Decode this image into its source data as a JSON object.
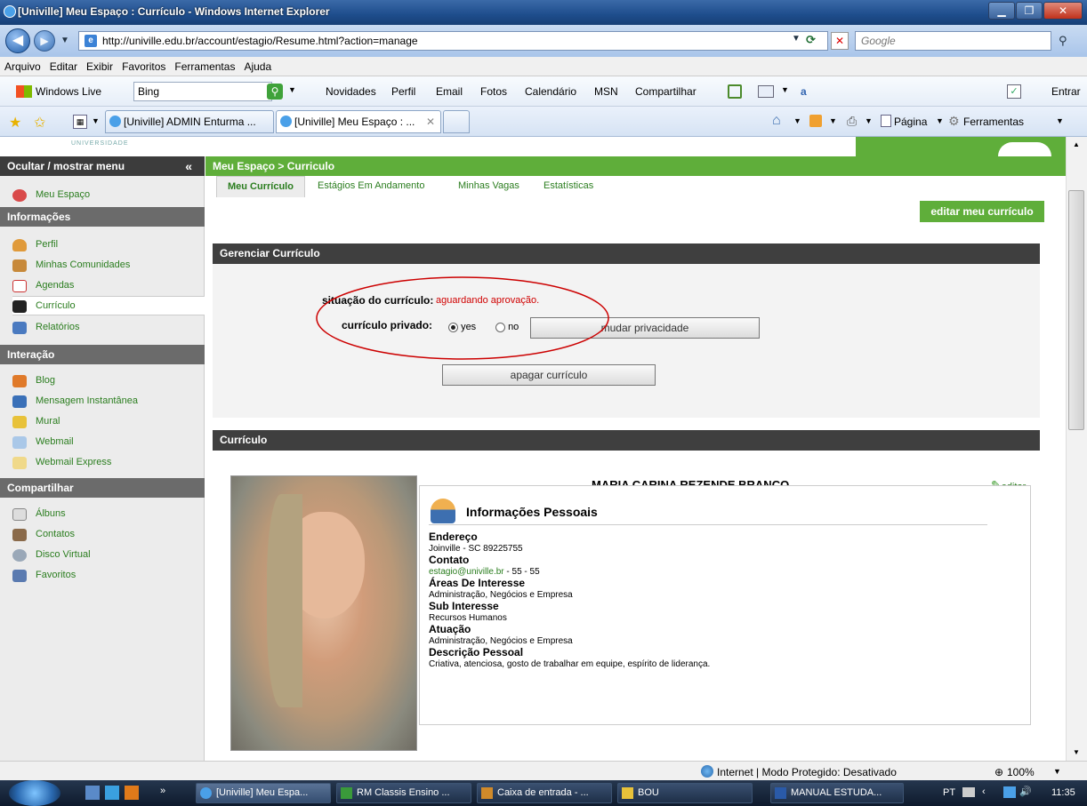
{
  "window": {
    "title": "[Univille] Meu Espaço : Currículo - Windows Internet Explorer"
  },
  "address": {
    "url": "http://univille.edu.br/account/estagio/Resume.html?action=manage",
    "search_placeholder": "Google"
  },
  "menu": [
    "Arquivo",
    "Editar",
    "Exibir",
    "Favoritos",
    "Ferramentas",
    "Ajuda"
  ],
  "livebar": {
    "brand": "Windows Live",
    "search_value": "Bing",
    "links": [
      "Novidades",
      "Perfil",
      "Email",
      "Fotos",
      "Calendário",
      "MSN",
      "Compartilhar"
    ],
    "signin": "Entrar"
  },
  "tabs": [
    "[Univille] ADMIN Enturma ...",
    "[Univille] Meu Espaço : ..."
  ],
  "tools": {
    "page": "Página",
    "tools": "Ferramentas"
  },
  "header": {
    "logo": "UNIVERSIDADE"
  },
  "sidebar": {
    "toggle": "Ocultar / mostrar menu",
    "home": "Meu Espaço",
    "sections": [
      {
        "title": "Informações",
        "items": [
          "Perfil",
          "Minhas Comunidades",
          "Agendas",
          "Currículo",
          "Relatórios"
        ]
      },
      {
        "title": "Interação",
        "items": [
          "Blog",
          "Mensagem Instantânea",
          "Mural",
          "Webmail",
          "Webmail Express"
        ]
      },
      {
        "title": "Compartilhar",
        "items": [
          "Álbuns",
          "Contatos",
          "Disco Virtual",
          "Favoritos"
        ]
      }
    ]
  },
  "content": {
    "breadcrumb": "Meu Espaço > Curriculo",
    "subtabs": [
      "Meu Currículo",
      "Estágios Em Andamento",
      "Minhas Vagas",
      "Estatísticas"
    ],
    "edit_cv": "editar meu currículo",
    "manage": {
      "title": "Gerenciar Currículo",
      "status_label": "situação do currículo:",
      "status_value": "aguardando aprovação.",
      "private_label": "currículo privado:",
      "opt_yes": "yes",
      "opt_no": "no",
      "change_privacy": "mudar privacidade",
      "delete_cv": "apagar currículo"
    },
    "cv": {
      "title": "Currículo",
      "name": "MARIA CARINA REZENDE BRANCO",
      "edit": "editar",
      "section_title": "Informações Pessoais",
      "address_label": "Endereço",
      "address_value": "Joinville - SC 89225755",
      "contact_label": "Contato",
      "contact_email": "estagio@univille.br",
      "contact_phone": "- 55 - 55",
      "interest_label": "Áreas De Interesse",
      "interest_value": "Administração, Negócios e Empresa",
      "sub_label": "Sub Interesse",
      "sub_value": "Recursos Humanos",
      "acting_label": "Atuação",
      "acting_value": "Administração, Negócios e Empresa",
      "desc_label": "Descrição Pessoal",
      "desc_value": "Criativa, atenciosa, gosto de trabalhar em equipe, espírito de liderança."
    }
  },
  "status": {
    "zone": "Internet | Modo Protegido: Desativado",
    "zoom": "100%"
  },
  "taskbar": {
    "tasks": [
      "[Univille] Meu Espa...",
      "RM Classis Ensino ...",
      "Caixa de entrada - ...",
      "BOU",
      "MANUAL ESTUDA..."
    ],
    "lang": "PT",
    "clock": "11:35"
  },
  "colors": {
    "brand_green": "#5fae3a",
    "status_red": "#d00000",
    "annotation_red": "#cc0000"
  }
}
